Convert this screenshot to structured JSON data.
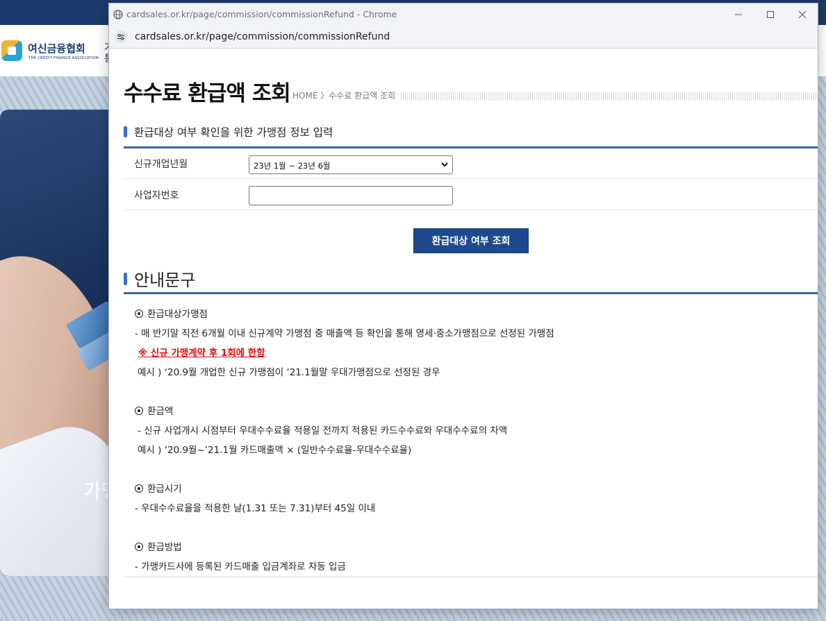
{
  "background": {
    "logo_korean": "여신금융협회",
    "logo_english": "THE CREDIT FINANCE ASSOCIATION",
    "nav_partial_1": "가",
    "nav_partial_2": "통",
    "slogan_partial": "가맹"
  },
  "window": {
    "title": "cardsales.or.kr/page/commission/commissionRefund - Chrome",
    "url": "cardsales.or.kr/page/commission/commissionRefund"
  },
  "page": {
    "title": "수수료 환급액 조회",
    "breadcrumb": "HOME 〉수수료 환급액 조회"
  },
  "form": {
    "section_title": "환급대상 여부 확인을 위한 가맹점 정보 입력",
    "open_month_label": "신규개업년월",
    "open_month_value": "23년 1월 ~ 23년 6월",
    "biz_number_label": "사업자번호",
    "biz_number_value": "",
    "submit_label": "환급대상 여부 조회"
  },
  "notice": {
    "section_title": "안내문구",
    "target_heading": "환급대상가맹점",
    "target_desc": "- 매 반기말 직전 6개월 이내 신규계약 가맹점 중 매출액 등 확인을 통해 영세·중소가맹점으로 선정된 가맹점",
    "target_warning": "※ 신규 가맹계약 후 1회에 한함",
    "target_example": "예시 ) ‘20.9월 개업한 신규 가맹점이 ’21.1월말 우대가맹점으로 선정된 경우",
    "amount_heading": "환급액",
    "amount_desc": "- 신규 사업개시 시점부터 우대수수료율 적용일 전까지 적용된 카드수수료와 우대수수료의 차액",
    "amount_example": "예시 ) ‘20.9월~’21.1월 카드매출액 × (일반수수료율-우대수수료율)",
    "timing_heading": "환급시기",
    "timing_desc": "- 우대수수료율을 적용한 날(1.31 또는 7.31)부터 45일 이내",
    "method_heading": "환급방법",
    "method_desc": "- 가맹카드사에 등록된 카드매출 입금계좌로 자동 입금"
  },
  "colors": {
    "accent_blue": "#1e4a8d",
    "section_bar": "#3a6fc6",
    "warning_red": "#e30b0b"
  }
}
